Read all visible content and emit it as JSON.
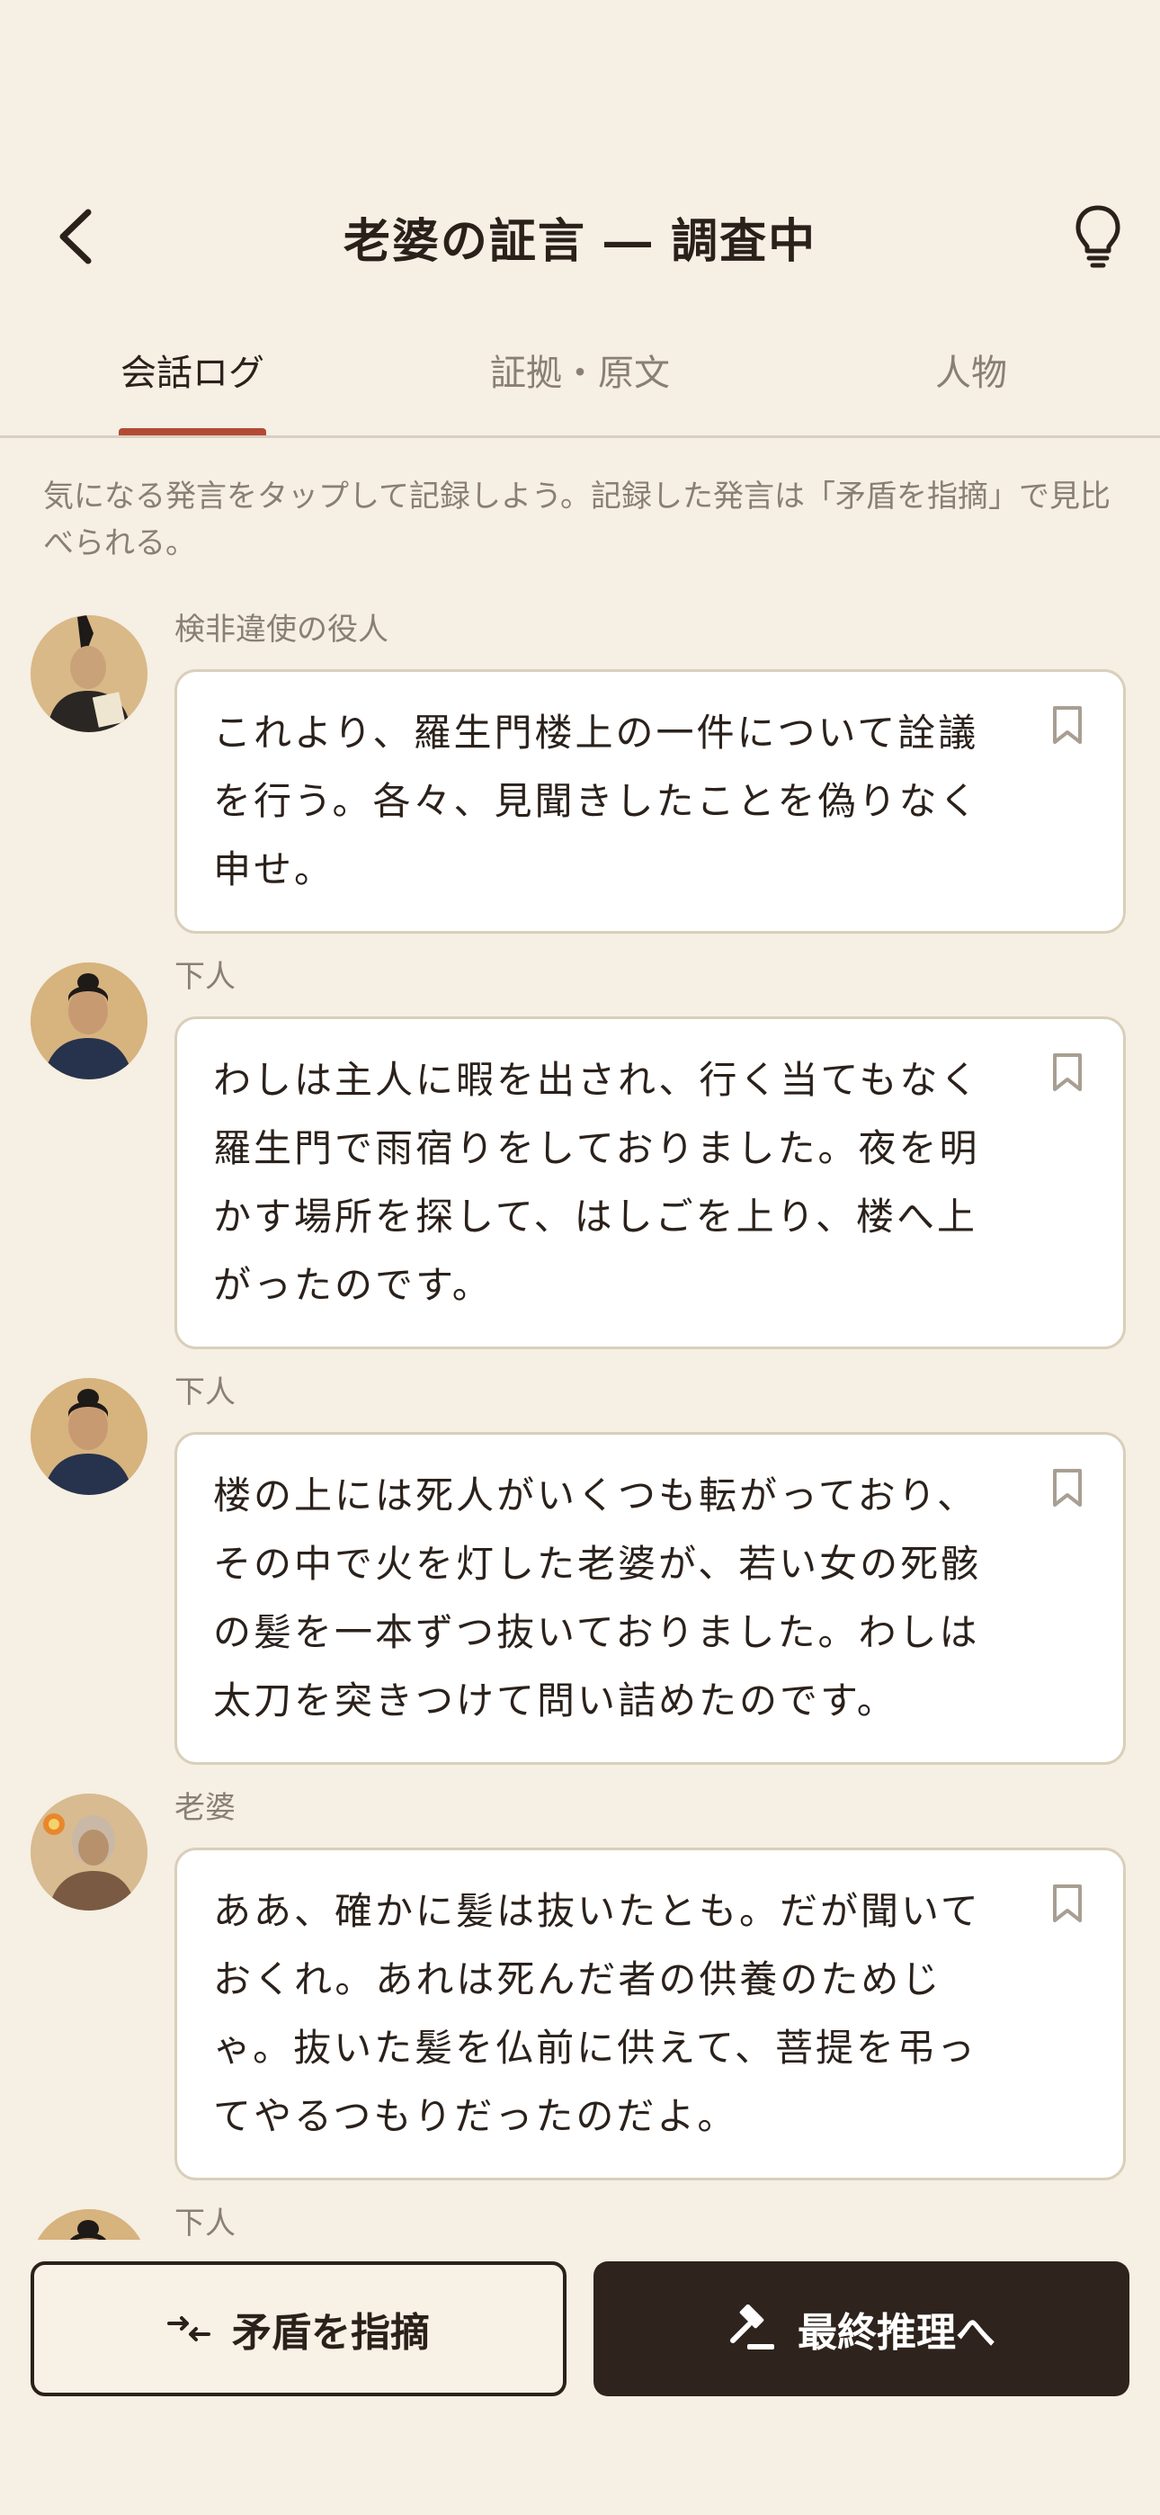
{
  "header": {
    "title": "老婆の証言 ― 調査中"
  },
  "tabs": [
    {
      "label": "会話ログ",
      "active": true
    },
    {
      "label": "証拠・原文",
      "active": false
    },
    {
      "label": "人物",
      "active": false
    }
  ],
  "instruction": "気になる発言をタップして記録しよう。記録した発言は「矛盾を指摘」で見比べられる。",
  "log": [
    {
      "speaker": "検非違使の役人",
      "text": "これより、羅生門楼上の一件について詮議を行う。各々、見聞きしたことを偽りなく申せ。",
      "avatar": "official-avatar"
    },
    {
      "speaker": "下人",
      "text": "わしは主人に暇を出され、行く当てもなく羅生門で雨宿りをしておりました。夜を明かす場所を探して、はしごを上り、楼へ上がったのです。",
      "avatar": "servant-avatar"
    },
    {
      "speaker": "下人",
      "text": "楼の上には死人がいくつも転がっており、その中で火を灯した老婆が、若い女の死骸の髪を一本ずつ抜いておりました。わしは太刀を突きつけて問い詰めたのです。",
      "avatar": "servant-avatar"
    },
    {
      "speaker": "老婆",
      "text": "ああ、確かに髪は抜いたとも。だが聞いておくれ。あれは死んだ者の供養のためじゃ。抜いた髪を仏前に供えて、菩提を弔ってやるつもりだったのだよ。",
      "avatar": "old-woman-avatar"
    },
    {
      "speaker": "下人",
      "text": "",
      "avatar": "servant-avatar"
    }
  ],
  "actions": {
    "contradiction_label": "矛盾を指摘",
    "final_label": "最終推理へ"
  },
  "colors": {
    "background": "#f5efe4",
    "accent": "#b24a35",
    "dark": "#2e231d"
  }
}
